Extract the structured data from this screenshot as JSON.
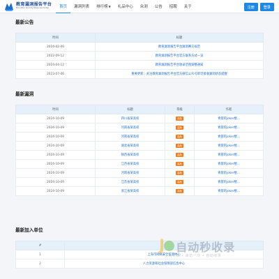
{
  "header": {
    "logo_title": "教育漏洞报告平台",
    "logo_sub": "Education Security Response Center",
    "nav": [
      {
        "label": "首页",
        "active": true
      },
      {
        "label": "漏洞列表",
        "active": false
      },
      {
        "label": "排行榜",
        "active": false,
        "dropdown": true
      },
      {
        "label": "礼品中心",
        "active": false
      },
      {
        "label": "众测",
        "active": false
      },
      {
        "label": "公告",
        "active": false
      },
      {
        "label": "招聘",
        "active": false
      },
      {
        "label": "关于",
        "active": false
      }
    ],
    "login_label": "注册",
    "register_label": "登录",
    "accent": "#1e88e5"
  },
  "announcements": {
    "title": "最新公告",
    "columns": [
      "时间",
      "标题"
    ],
    "rows": [
      {
        "time": "2024-02-06",
        "title": "教育漏洞报告平台漏洞赛交规范"
      },
      {
        "time": "2022-09-12",
        "title": "教育漏洞报告平台官方联系方式一览"
      },
      {
        "time": "2024-04-12",
        "title": "教育漏洞报告平台收录范围调整通知"
      },
      {
        "time": "2023-07-06",
        "title": "重要更新：关注教育漏洞报告平台官方微信公众号即可接收漏洞状态提醒"
      }
    ]
  },
  "vulns": {
    "title": "最新漏洞",
    "columns": [
      "时间",
      "标题",
      "等级",
      "作者"
    ],
    "rows": [
      {
        "time": "2024-10-09",
        "title": "四川省某高校",
        "level": "高危",
        "author": "青蓉的joker棍..."
      },
      {
        "time": "2024-10-09",
        "title": "河南省某高校",
        "level": "高危",
        "author": "青蓉的joker棍..."
      },
      {
        "time": "2024-10-09",
        "title": "河南省某高校",
        "level": "高危",
        "author": "青蓉的joker棍..."
      },
      {
        "time": "2024-10-09",
        "title": "湖北省某高校",
        "level": "高危",
        "author": "青蓉的joker棍..."
      },
      {
        "time": "2024-10-09",
        "title": "陕西省某高校",
        "level": "高危",
        "author": "青蓉的joker棍..."
      },
      {
        "time": "2024-10-09",
        "title": "江西省某高校",
        "level": "高危",
        "author": "青蓉的joker棍..."
      },
      {
        "time": "2024-10-09",
        "title": "河南省某高校",
        "level": "高危",
        "author": "青蓉的joker棍..."
      },
      {
        "time": "2024-10-09",
        "title": "江苏省某高校",
        "level": "高危",
        "author": "青蓉的joker棍..."
      },
      {
        "time": "2024-10-09",
        "title": "浙江省某高校",
        "level": "高危",
        "author": "青蓉的joker棍..."
      }
    ],
    "badge_color": "#f07b1d"
  },
  "members": {
    "title": "最新加入单位",
    "columns": [
      "#",
      ""
    ],
    "rows": [
      {
        "index": "1",
        "name": "上海市网络安全监测中心"
      },
      {
        "index": "2",
        "name": "人力资源和社会保障部信息中心"
      }
    ]
  },
  "watermark": {
    "text": "自动秒收录",
    "sub": "上网导航 • 来访一次 • 自动收录"
  }
}
